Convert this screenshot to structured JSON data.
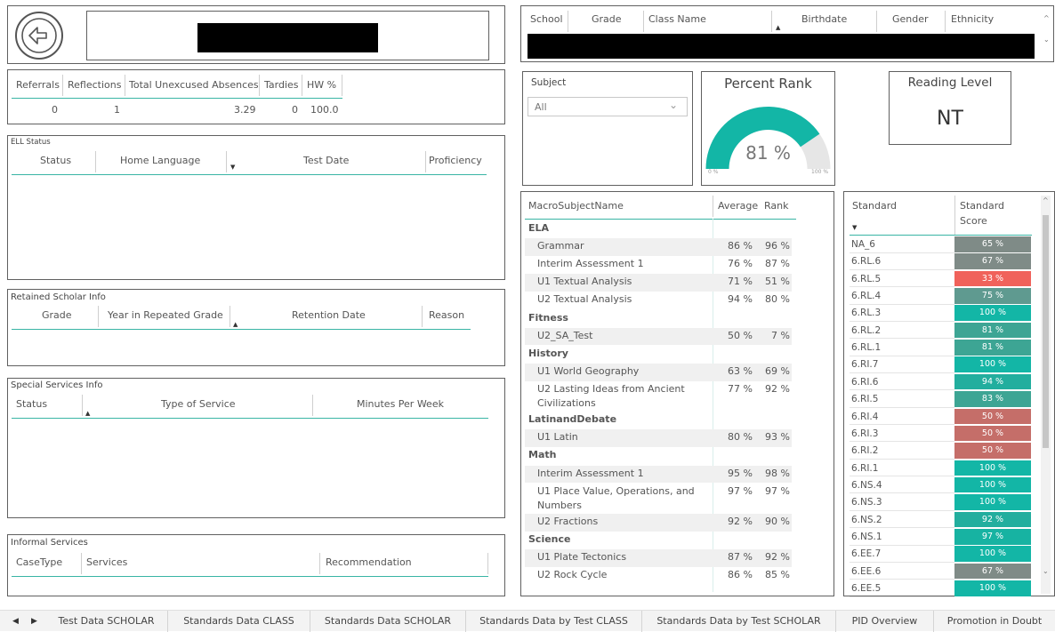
{
  "header": {
    "back_button": "back-arrow-icon"
  },
  "scholar_table": {
    "columns": [
      "School",
      "Grade",
      "Class Name",
      "Birthdate",
      "Gender",
      "Ethnicity"
    ]
  },
  "summary": {
    "columns": [
      "Referrals",
      "Reflections",
      "Total Unexcused Absences",
      "Tardies",
      "HW %"
    ],
    "values": [
      "0",
      "1",
      "3.29",
      "0",
      "100.0"
    ]
  },
  "ell": {
    "title": "ELL Status",
    "columns": [
      "Status",
      "Home Language",
      "Test Date",
      "Proficiency"
    ]
  },
  "retained": {
    "title": "Retained Scholar Info",
    "columns": [
      "Grade",
      "Year in Repeated Grade",
      "Retention Date",
      "Reason"
    ]
  },
  "special": {
    "title": "Special Services Info",
    "columns": [
      "Status",
      "Type of Service",
      "Minutes Per Week"
    ]
  },
  "informal": {
    "title": "Informal Services",
    "columns": [
      "CaseType",
      "Services",
      "Recommendation"
    ]
  },
  "subject": {
    "label": "Subject",
    "value": "All"
  },
  "percent_rank": {
    "title": "Percent Rank",
    "value": "81 %",
    "fraction": 0.81,
    "min_label": "0 %",
    "max_label": "100 %",
    "fill_color": "#13b6a6",
    "track_color": "#e6e6e6"
  },
  "reading_level": {
    "title": "Reading Level",
    "value": "NT"
  },
  "macro": {
    "columns": [
      "MacroSubjectName",
      "Average",
      "Rank"
    ],
    "rows": [
      {
        "group": true,
        "name": "ELA"
      },
      {
        "name": "Grammar",
        "avg": "86 %",
        "rank": "96 %"
      },
      {
        "name": "Interim Assessment 1",
        "avg": "76 %",
        "rank": "87 %"
      },
      {
        "name": "U1 Textual Analysis",
        "avg": "71 %",
        "rank": "51 %"
      },
      {
        "name": "U2 Textual Analysis",
        "avg": "94 %",
        "rank": "80 %"
      },
      {
        "group": true,
        "name": "Fitness"
      },
      {
        "name": "U2_SA_Test",
        "avg": "50 %",
        "rank": "7 %"
      },
      {
        "group": true,
        "name": "History"
      },
      {
        "name": "U1 World Geography",
        "avg": "63 %",
        "rank": "69 %"
      },
      {
        "name": "U2 Lasting Ideas from Ancient",
        "name2": "Civilizations",
        "avg": "77 %",
        "rank": "92 %"
      },
      {
        "group": true,
        "name": "LatinandDebate"
      },
      {
        "name": "U1 Latin",
        "avg": "80 %",
        "rank": "93 %"
      },
      {
        "group": true,
        "name": "Math"
      },
      {
        "name": "Interim Assessment 1",
        "avg": "95 %",
        "rank": "98 %"
      },
      {
        "name": "U1 Place Value, Operations, and",
        "name2": "Numbers",
        "avg": "97 %",
        "rank": "97 %"
      },
      {
        "name": "U2 Fractions",
        "avg": "92 %",
        "rank": "90 %"
      },
      {
        "group": true,
        "name": "Science"
      },
      {
        "name": "U1 Plate Tectonics",
        "avg": "87 %",
        "rank": "92 %"
      },
      {
        "name": "U2 Rock Cycle",
        "avg": "86 %",
        "rank": "85 %"
      }
    ]
  },
  "standards": {
    "col1": "Standard",
    "col2a": "Standard",
    "col2b": "Score",
    "rows": [
      {
        "code": "NA_6",
        "score": "65 %",
        "color": "#7f8b87"
      },
      {
        "code": "6.RL.6",
        "score": "67 %",
        "color": "#7f8b87"
      },
      {
        "code": "6.RL.5",
        "score": "33 %",
        "color": "#f0625b"
      },
      {
        "code": "6.RL.4",
        "score": "75 %",
        "color": "#5f9a90"
      },
      {
        "code": "6.RL.3",
        "score": "100 %",
        "color": "#13b6a6"
      },
      {
        "code": "6.RL.2",
        "score": "81 %",
        "color": "#3da594"
      },
      {
        "code": "6.RL.1",
        "score": "81 %",
        "color": "#3da594"
      },
      {
        "code": "6.RI.7",
        "score": "100 %",
        "color": "#13b6a6"
      },
      {
        "code": "6.RI.6",
        "score": "94 %",
        "color": "#22ae9e"
      },
      {
        "code": "6.RI.5",
        "score": "83 %",
        "color": "#3da594"
      },
      {
        "code": "6.RI.4",
        "score": "50 %",
        "color": "#c56e69"
      },
      {
        "code": "6.RI.3",
        "score": "50 %",
        "color": "#c56e69"
      },
      {
        "code": "6.RI.2",
        "score": "50 %",
        "color": "#c56e69"
      },
      {
        "code": "6.RI.1",
        "score": "100 %",
        "color": "#13b6a6"
      },
      {
        "code": "6.NS.4",
        "score": "100 %",
        "color": "#13b6a6"
      },
      {
        "code": "6.NS.3",
        "score": "100 %",
        "color": "#13b6a6"
      },
      {
        "code": "6.NS.2",
        "score": "92 %",
        "color": "#22ae9e"
      },
      {
        "code": "6.NS.1",
        "score": "97 %",
        "color": "#17b3a2"
      },
      {
        "code": "6.EE.7",
        "score": "100 %",
        "color": "#13b6a6"
      },
      {
        "code": "6.EE.6",
        "score": "67 %",
        "color": "#7f8b87"
      },
      {
        "code": "6.EE.5",
        "score": "100 %",
        "color": "#13b6a6"
      }
    ]
  },
  "tabs": [
    "Test Data SCHOLAR",
    "Standards Data CLASS",
    "Standards Data SCHOLAR",
    "Standards Data by Test CLASS",
    "Standards Data by Test SCHOLAR",
    "PID Overview",
    "Promotion in Doubt"
  ]
}
